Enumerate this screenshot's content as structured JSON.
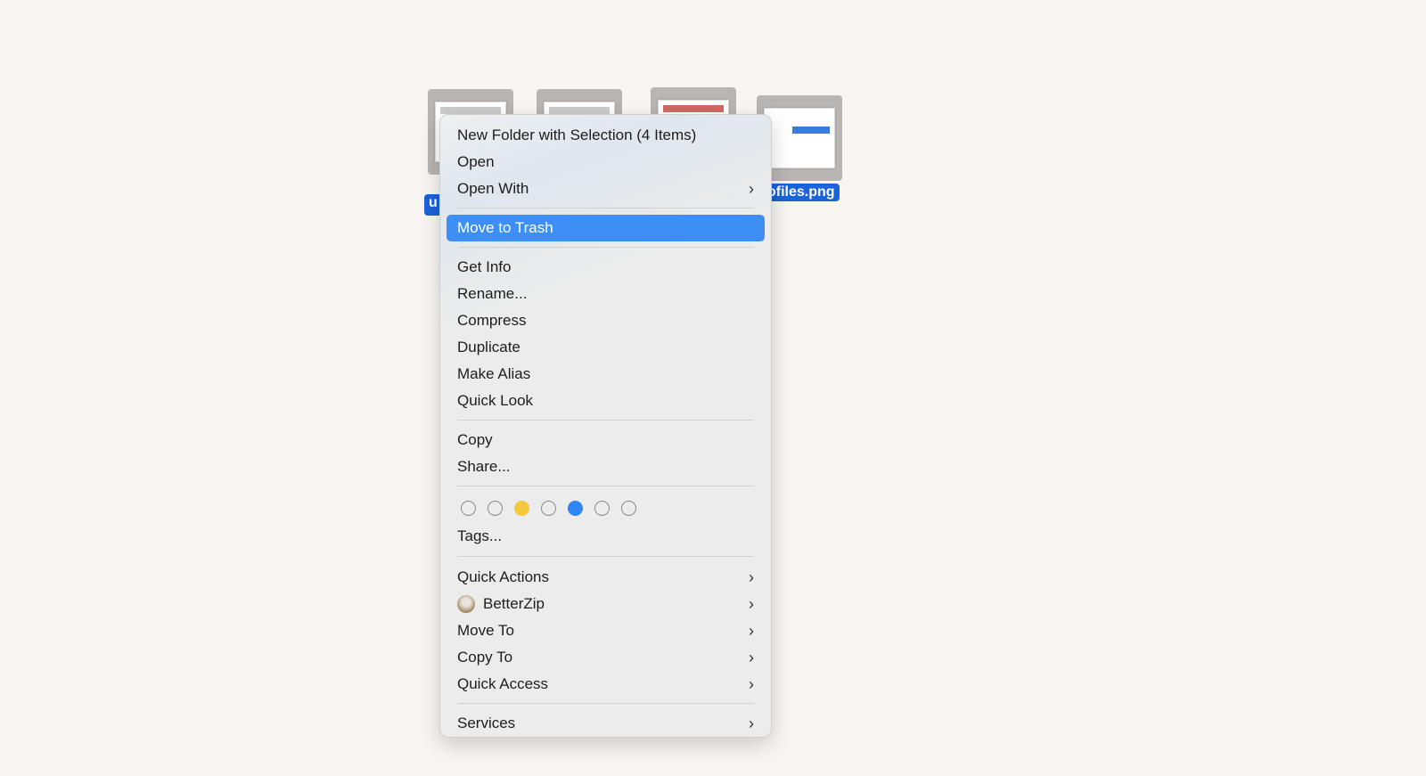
{
  "desktop": {
    "files": [
      {
        "label": "u"
      },
      {
        "label": ""
      },
      {
        "label": ""
      },
      {
        "label": "ofiles.png"
      }
    ]
  },
  "menu": {
    "group1": [
      {
        "label": "New Folder with Selection (4 Items)"
      },
      {
        "label": "Open"
      },
      {
        "label": "Open With",
        "submenu": true
      }
    ],
    "highlighted": {
      "label": "Move to Trash"
    },
    "group2": [
      {
        "label": "Get Info"
      },
      {
        "label": "Rename..."
      },
      {
        "label": "Compress"
      },
      {
        "label": "Duplicate"
      },
      {
        "label": "Make Alias"
      },
      {
        "label": "Quick Look"
      }
    ],
    "group3": [
      {
        "label": "Copy"
      },
      {
        "label": "Share..."
      }
    ],
    "tag_colors": [
      "none",
      "none",
      "#f6c83e",
      "none",
      "#2f86f5",
      "none",
      "none"
    ],
    "tags_label": "Tags...",
    "group4": [
      {
        "label": "Quick Actions",
        "submenu": true
      },
      {
        "label": "BetterZip",
        "submenu": true,
        "icon": "betterzip-icon"
      },
      {
        "label": "Move To",
        "submenu": true
      },
      {
        "label": "Copy To",
        "submenu": true
      },
      {
        "label": "Quick Access",
        "submenu": true
      }
    ],
    "services": {
      "label": "Services",
      "submenu": true
    },
    "chevron": "›",
    "highlight_color": "#3d8ff5"
  }
}
